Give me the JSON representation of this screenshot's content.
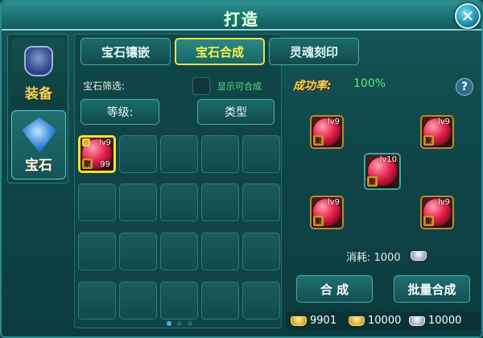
{
  "window": {
    "title": "打造"
  },
  "sidebar": {
    "items": [
      {
        "label": "装备"
      },
      {
        "label": "宝石"
      }
    ]
  },
  "tabs": [
    {
      "label": "宝石镶嵌"
    },
    {
      "label": "宝石合成"
    },
    {
      "label": "灵魂刻印"
    }
  ],
  "filter": {
    "label": "宝石筛选:",
    "show_synthesizable_label": "显示可合成",
    "level_button": "等级:",
    "type_button": "类型"
  },
  "inventory": {
    "items": [
      {
        "level": "lv9",
        "tag": "聚",
        "count": "99",
        "locked": true
      }
    ],
    "page_count": 3,
    "current_page": 1
  },
  "synthesis": {
    "success_label": "成功率:",
    "success_rate": "100%",
    "input_gems": [
      {
        "level": "lv9",
        "tag": "聚"
      },
      {
        "level": "lv9",
        "tag": "聚"
      },
      {
        "level": "lv9",
        "tag": "聚"
      },
      {
        "level": "lv9",
        "tag": "聚"
      }
    ],
    "result_gem": {
      "level": "lv10",
      "tag": "聚"
    },
    "cost_label": "消耗: 1000",
    "synthesize_button": "合 成",
    "batch_button": "批量合成"
  },
  "currency": [
    {
      "icon": "gold-ingot-icon",
      "value": "9901"
    },
    {
      "icon": "gold-ingot-icon",
      "value": "10000"
    },
    {
      "icon": "silver-ingot-icon",
      "value": "10000"
    }
  ]
}
